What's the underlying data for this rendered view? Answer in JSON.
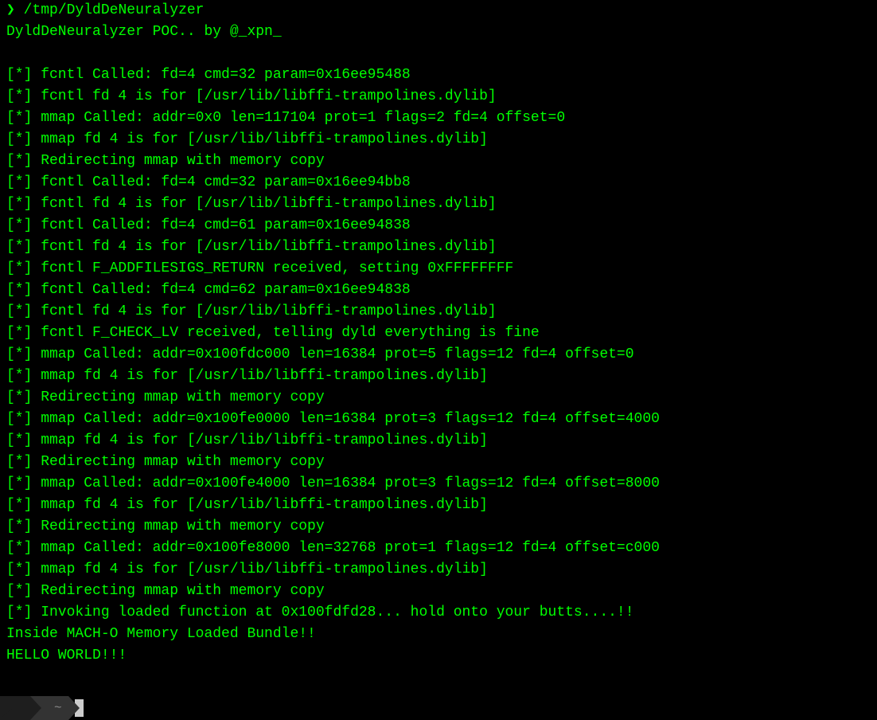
{
  "prompt": {
    "symbol": "❯",
    "command": " /tmp/DyldDeNeuralyzer"
  },
  "lines": [
    "DyldDeNeuralyzer POC.. by @_xpn_",
    "",
    "[*] fcntl Called: fd=4 cmd=32 param=0x16ee95488",
    "[*] fcntl fd 4 is for [/usr/lib/libffi-trampolines.dylib]",
    "[*] mmap Called: addr=0x0 len=117104 prot=1 flags=2 fd=4 offset=0",
    "[*] mmap fd 4 is for [/usr/lib/libffi-trampolines.dylib]",
    "[*] Redirecting mmap with memory copy",
    "[*] fcntl Called: fd=4 cmd=32 param=0x16ee94bb8",
    "[*] fcntl fd 4 is for [/usr/lib/libffi-trampolines.dylib]",
    "[*] fcntl Called: fd=4 cmd=61 param=0x16ee94838",
    "[*] fcntl fd 4 is for [/usr/lib/libffi-trampolines.dylib]",
    "[*] fcntl F_ADDFILESIGS_RETURN received, setting 0xFFFFFFFF",
    "[*] fcntl Called: fd=4 cmd=62 param=0x16ee94838",
    "[*] fcntl fd 4 is for [/usr/lib/libffi-trampolines.dylib]",
    "[*] fcntl F_CHECK_LV received, telling dyld everything is fine",
    "[*] mmap Called: addr=0x100fdc000 len=16384 prot=5 flags=12 fd=4 offset=0",
    "[*] mmap fd 4 is for [/usr/lib/libffi-trampolines.dylib]",
    "[*] Redirecting mmap with memory copy",
    "[*] mmap Called: addr=0x100fe0000 len=16384 prot=3 flags=12 fd=4 offset=4000",
    "[*] mmap fd 4 is for [/usr/lib/libffi-trampolines.dylib]",
    "[*] Redirecting mmap with memory copy",
    "[*] mmap Called: addr=0x100fe4000 len=16384 prot=3 flags=12 fd=4 offset=8000",
    "[*] mmap fd 4 is for [/usr/lib/libffi-trampolines.dylib]",
    "[*] Redirecting mmap with memory copy",
    "[*] mmap Called: addr=0x100fe8000 len=32768 prot=1 flags=12 fd=4 offset=c000",
    "[*] mmap fd 4 is for [/usr/lib/libffi-trampolines.dylib]",
    "[*] Redirecting mmap with memory copy",
    "[*] Invoking loaded function at 0x100fdfd28... hold onto your butts....!!",
    "Inside MACH-O Memory Loaded Bundle!!",
    "HELLO WORLD!!!"
  ],
  "statusbar": {
    "apple": "",
    "home": "",
    "tilde": "~"
  }
}
